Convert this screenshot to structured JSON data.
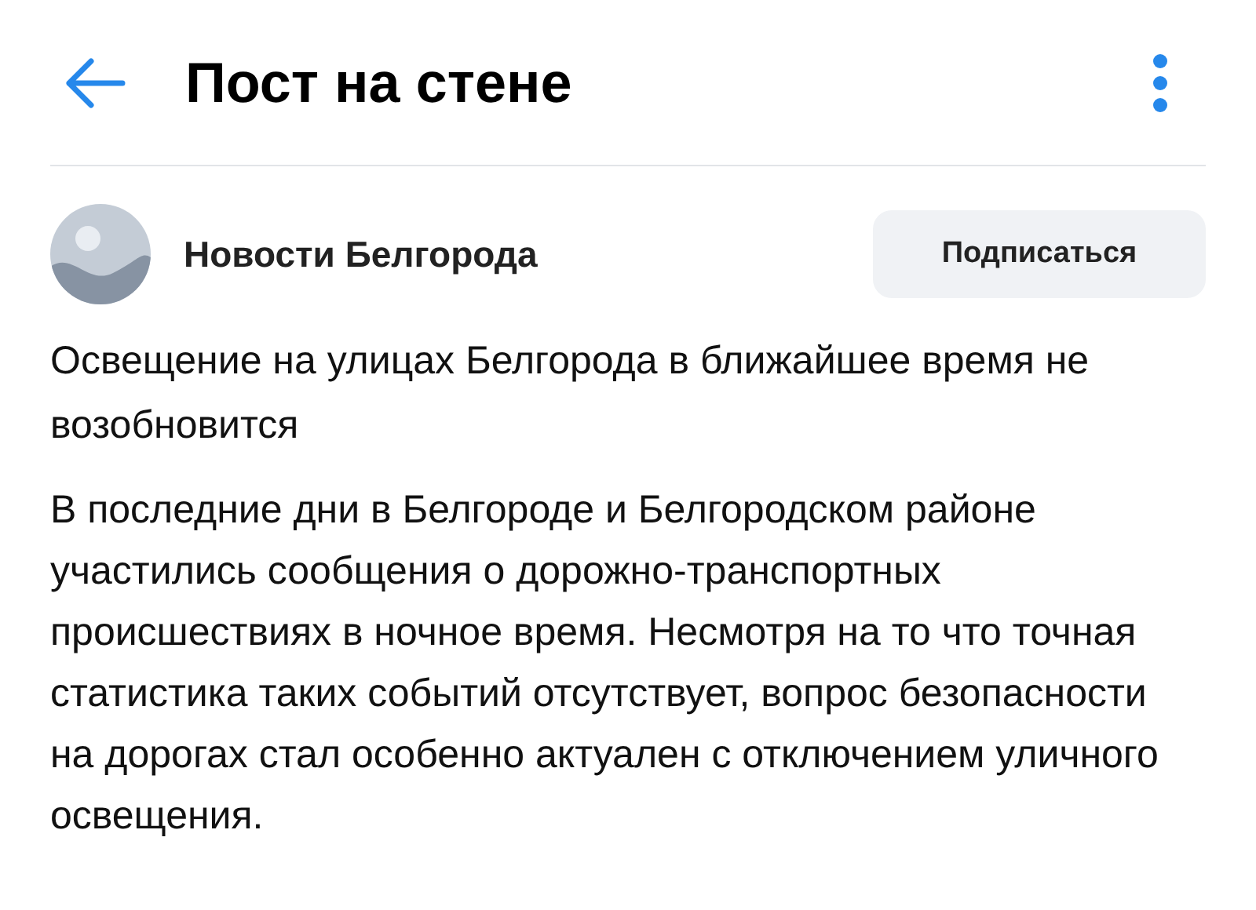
{
  "header": {
    "title": "Пост на стене"
  },
  "post": {
    "author": "Новости Белгорода",
    "subscribe_label": "Подписаться",
    "title": "Освещение на улицах Белгорода в ближайшее время не возобновится",
    "body": "В последние дни в Белгороде и Белгородском районе участились сообщения о дорожно-транспортных происшествиях в ночное время. Несмотря на то что точная статистика таких событий отсутствует, вопрос безопасности на дорогах стал особенно актуален с отключением уличного освещения."
  }
}
